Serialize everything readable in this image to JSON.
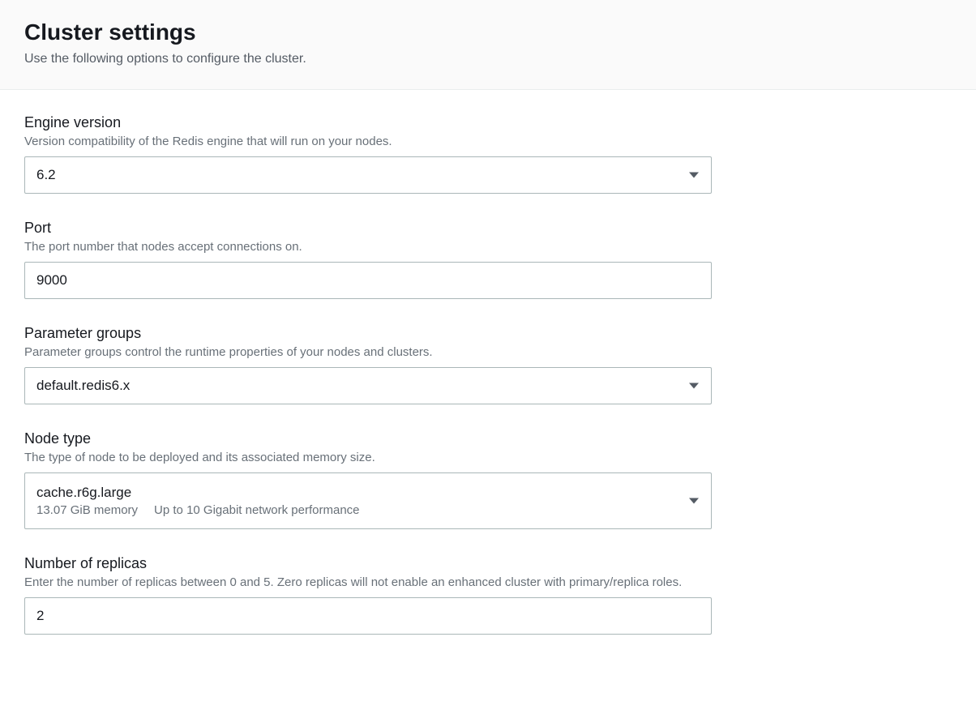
{
  "header": {
    "title": "Cluster settings",
    "subtitle": "Use the following options to configure the cluster."
  },
  "fields": {
    "engineVersion": {
      "label": "Engine version",
      "description": "Version compatibility of the Redis engine that will run on your nodes.",
      "value": "6.2"
    },
    "port": {
      "label": "Port",
      "description": "The port number that nodes accept connections on.",
      "value": "9000"
    },
    "parameterGroups": {
      "label": "Parameter groups",
      "description": "Parameter groups control the runtime properties of your nodes and clusters.",
      "value": "default.redis6.x"
    },
    "nodeType": {
      "label": "Node type",
      "description": "The type of node to be deployed and its associated memory size.",
      "value": "cache.r6g.large",
      "memory": "13.07 GiB memory",
      "network": "Up to 10 Gigabit network performance"
    },
    "replicas": {
      "label": "Number of replicas",
      "description": "Enter the number of replicas between 0 and 5. Zero replicas will not enable an enhanced cluster with primary/replica roles.",
      "value": "2"
    }
  }
}
